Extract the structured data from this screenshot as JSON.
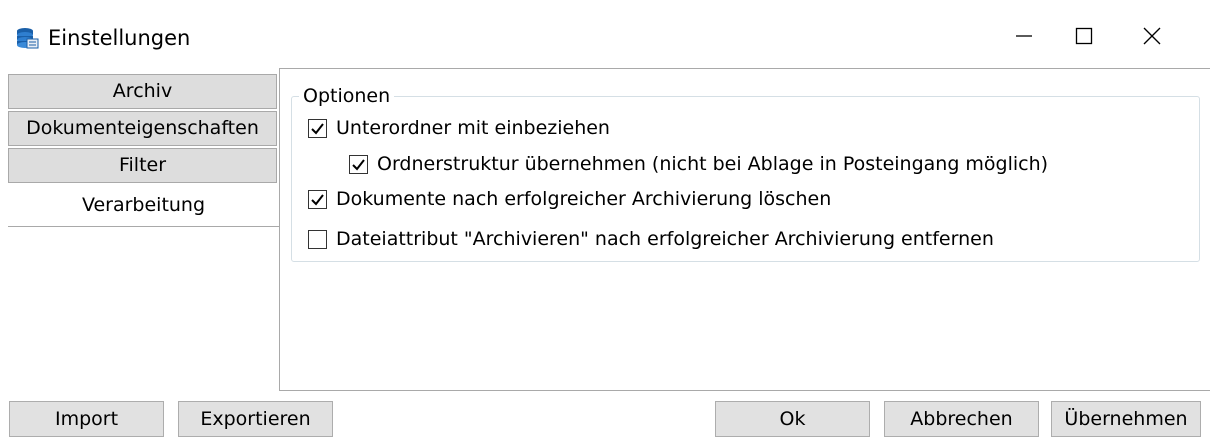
{
  "window": {
    "title": "Einstellungen",
    "app_icon": "database-stack-icon",
    "controls": {
      "minimize_icon": "minimize-icon",
      "maximize_icon": "maximize-icon",
      "close_icon": "close-icon"
    }
  },
  "tabs": [
    {
      "label": "Archiv",
      "selected": false
    },
    {
      "label": "Dokumenteigenschaften",
      "selected": false
    },
    {
      "label": "Filter",
      "selected": false
    },
    {
      "label": "Verarbeitung",
      "selected": true
    }
  ],
  "options_group": {
    "legend": "Optionen",
    "items": [
      {
        "label": "Unterordner mit einbeziehen",
        "checked": true
      },
      {
        "label": "Ordnerstruktur übernehmen (nicht bei Ablage in Posteingang möglich)",
        "checked": true
      },
      {
        "label": "Dokumente nach erfolgreicher Archivierung löschen",
        "checked": true
      },
      {
        "label": "Dateiattribut \"Archivieren\" nach erfolgreicher Archivierung entfernen",
        "checked": false
      }
    ]
  },
  "buttons": {
    "import": "Import",
    "export": "Exportieren",
    "ok": "Ok",
    "cancel": "Abbrechen",
    "apply": "Übernehmen"
  },
  "colors": {
    "tab_bg": "#dddddd",
    "button_bg": "#e1e1e1",
    "border": "#a9a9a9",
    "group_border": "#d5dfe5",
    "icon_blue": "#1a5fa8"
  }
}
